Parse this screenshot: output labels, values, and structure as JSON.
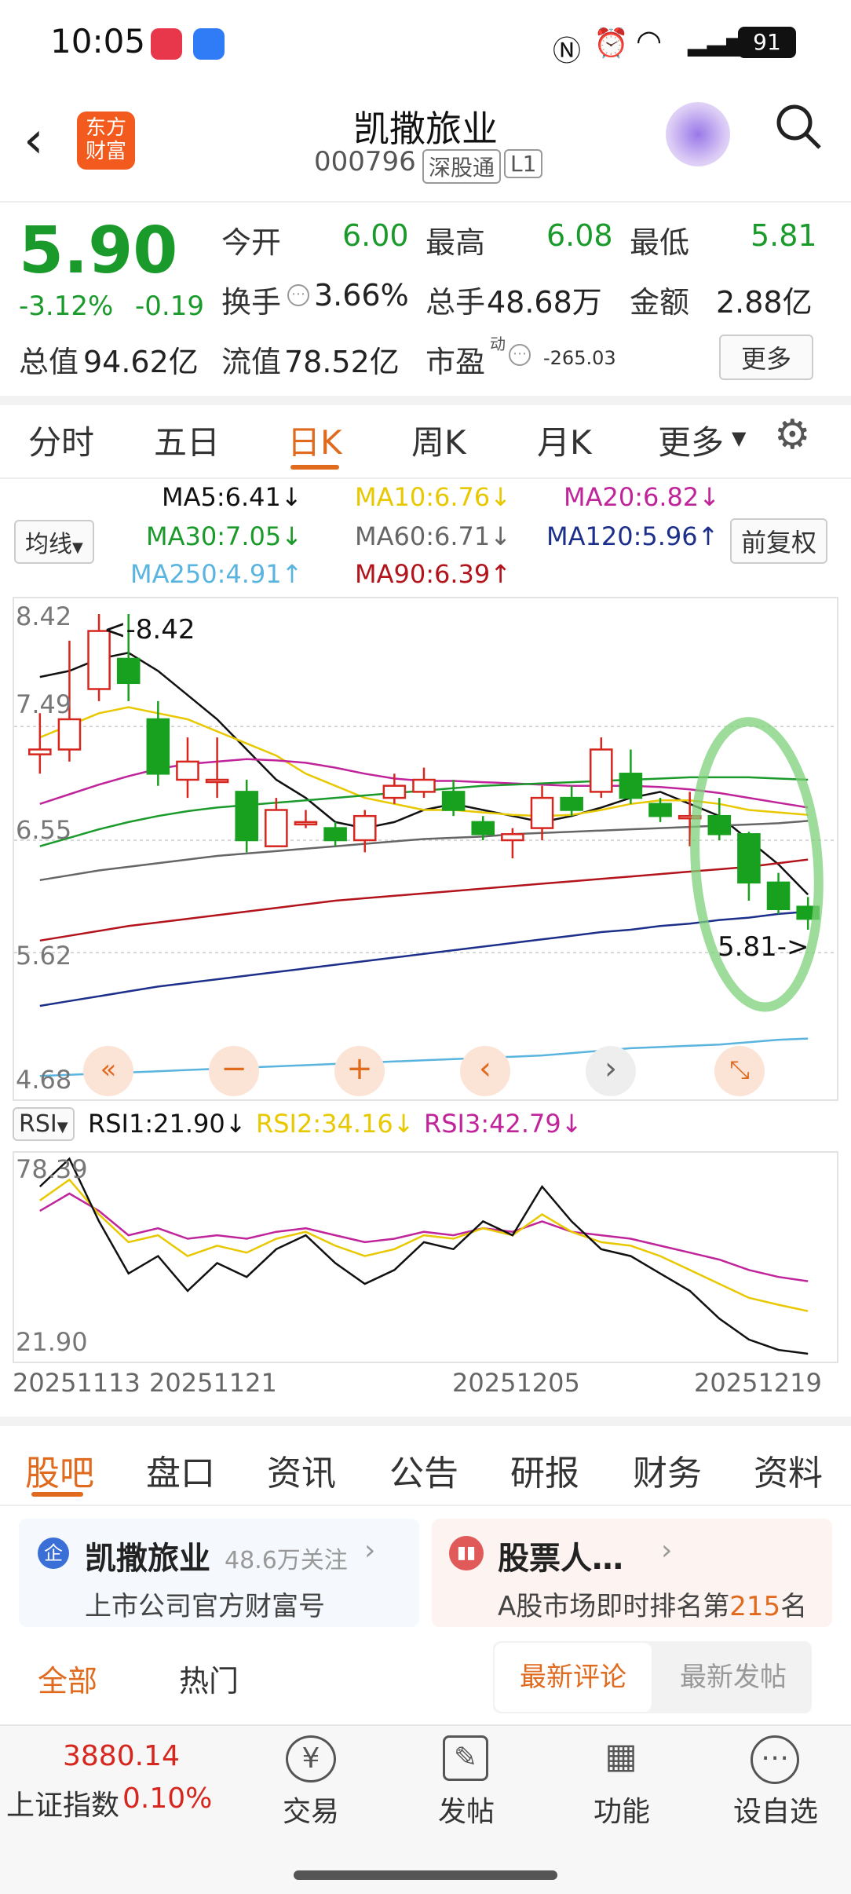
{
  "status_bar": {
    "time": "10:05",
    "battery": "91"
  },
  "header": {
    "title": "凯撒旅业",
    "code": "000796",
    "tag1": "深股通",
    "tag2": "L1",
    "logo_text": "东方财富"
  },
  "quote": {
    "price": "5.90",
    "change_pct": "-3.12%",
    "change": "-0.19",
    "open_label": "今开",
    "open": "6.00",
    "high_label": "最高",
    "high": "6.08",
    "low_label": "最低",
    "low": "5.81",
    "turnover_label": "换手",
    "turnover": "3.66%",
    "volume_label": "总手",
    "volume": "48.68万",
    "amount_label": "金额",
    "amount": "2.88亿",
    "mcap_label": "总值",
    "mcap": "94.62亿",
    "float_label": "流值",
    "float": "78.52亿",
    "pe_label": "市盈",
    "pe_sup": "动",
    "pe": "-265.03",
    "more": "更多"
  },
  "chart_tabs": [
    "分时",
    "五日",
    "日K",
    "周K",
    "月K",
    "更多"
  ],
  "ma_legend": {
    "ma5": "MA5:6.41↓",
    "ma10": "MA10:6.76↓",
    "ma20": "MA20:6.82↓",
    "ma30": "MA30:7.05↓",
    "ma60": "MA60:6.71↓",
    "ma120": "MA120:5.96↑",
    "ma250": "MA250:4.91↑",
    "ma90": "MA90:6.39↑",
    "line_select": "均线",
    "adjust": "前复权",
    "colors": {
      "ma5": "#111111",
      "ma10": "#e8c800",
      "ma20": "#c0249a",
      "ma30": "#1a9a2a",
      "ma60": "#666666",
      "ma120": "#1c2f8a",
      "ma250": "#5ab4e0",
      "ma90": "#b3131a"
    }
  },
  "kline": {
    "y_labels": [
      "8.42",
      "7.49",
      "6.55",
      "5.62",
      "4.68"
    ],
    "high_marker": "<-8.42",
    "low_marker": "5.81->"
  },
  "rsi": {
    "select": "RSI",
    "rsi1": "RSI1:21.90↓",
    "rsi2": "RSI2:34.16↓",
    "rsi3": "RSI3:42.79↓",
    "top": "78.39",
    "bottom": "21.90"
  },
  "dates": [
    "20251113",
    "20251121",
    "20251205",
    "20251219"
  ],
  "chart_data": {
    "type": "candlestick",
    "x": [
      "20251113",
      "20251121",
      "20251205",
      "20251219"
    ],
    "ylim": [
      4.68,
      8.42
    ],
    "candles": [
      {
        "o": 7.26,
        "c": 7.3,
        "h": 7.6,
        "l": 7.1
      },
      {
        "o": 7.3,
        "c": 7.55,
        "h": 8.2,
        "l": 7.2
      },
      {
        "o": 7.8,
        "c": 8.28,
        "h": 8.42,
        "l": 7.7
      },
      {
        "o": 8.05,
        "c": 7.85,
        "h": 8.42,
        "l": 7.7
      },
      {
        "o": 7.55,
        "c": 7.1,
        "h": 7.7,
        "l": 7.0
      },
      {
        "o": 7.05,
        "c": 7.2,
        "h": 7.4,
        "l": 6.9
      },
      {
        "o": 7.05,
        "c": 7.05,
        "h": 7.4,
        "l": 6.9
      },
      {
        "o": 6.95,
        "c": 6.55,
        "h": 7.05,
        "l": 6.45
      },
      {
        "o": 6.5,
        "c": 6.8,
        "h": 6.9,
        "l": 6.5
      },
      {
        "o": 6.7,
        "c": 6.7,
        "h": 6.8,
        "l": 6.65
      },
      {
        "o": 6.65,
        "c": 6.55,
        "h": 6.7,
        "l": 6.5
      },
      {
        "o": 6.55,
        "c": 6.75,
        "h": 6.8,
        "l": 6.45
      },
      {
        "o": 6.9,
        "c": 7.0,
        "h": 7.1,
        "l": 6.85
      },
      {
        "o": 6.95,
        "c": 7.05,
        "h": 7.15,
        "l": 6.9
      },
      {
        "o": 6.95,
        "c": 6.8,
        "h": 7.05,
        "l": 6.75
      },
      {
        "o": 6.7,
        "c": 6.6,
        "h": 6.75,
        "l": 6.55
      },
      {
        "o": 6.55,
        "c": 6.6,
        "h": 6.65,
        "l": 6.4
      },
      {
        "o": 6.65,
        "c": 6.9,
        "h": 7.0,
        "l": 6.55
      },
      {
        "o": 6.9,
        "c": 6.8,
        "h": 7.0,
        "l": 6.75
      },
      {
        "o": 6.95,
        "c": 7.3,
        "h": 7.4,
        "l": 6.9
      },
      {
        "o": 7.1,
        "c": 6.9,
        "h": 7.3,
        "l": 6.85
      },
      {
        "o": 6.85,
        "c": 6.75,
        "h": 6.9,
        "l": 6.7
      },
      {
        "o": 6.75,
        "c": 6.75,
        "h": 6.95,
        "l": 6.5
      },
      {
        "o": 6.75,
        "c": 6.6,
        "h": 6.9,
        "l": 6.55
      },
      {
        "o": 6.6,
        "c": 6.2,
        "h": 6.62,
        "l": 6.05
      },
      {
        "o": 6.2,
        "c": 5.98,
        "h": 6.28,
        "l": 5.94
      },
      {
        "o": 6.0,
        "c": 5.9,
        "h": 6.08,
        "l": 5.81
      }
    ],
    "ma": {
      "ma5": [
        7.9,
        7.95,
        8.05,
        8.1,
        7.95,
        7.75,
        7.55,
        7.3,
        7.05,
        6.9,
        6.7,
        6.65,
        6.7,
        6.8,
        6.85,
        6.8,
        6.75,
        6.7,
        6.75,
        6.82,
        6.9,
        6.95,
        6.85,
        6.75,
        6.55,
        6.35,
        6.1
      ],
      "ma10": [
        7.4,
        7.5,
        7.6,
        7.65,
        7.6,
        7.55,
        7.45,
        7.35,
        7.25,
        7.1,
        7.0,
        6.9,
        6.85,
        6.8,
        6.8,
        6.78,
        6.76,
        6.75,
        6.76,
        6.8,
        6.85,
        6.88,
        6.88,
        6.85,
        6.8,
        6.78,
        6.76
      ],
      "ma20": [
        6.85,
        6.93,
        7.01,
        7.08,
        7.14,
        7.18,
        7.2,
        7.22,
        7.21,
        7.19,
        7.15,
        7.1,
        7.06,
        7.04,
        7.04,
        7.03,
        7.02,
        7.01,
        7.0,
        7.0,
        7.0,
        6.99,
        6.97,
        6.94,
        6.9,
        6.86,
        6.82
      ],
      "ma30": [
        6.5,
        6.57,
        6.64,
        6.7,
        6.75,
        6.79,
        6.82,
        6.84,
        6.86,
        6.88,
        6.9,
        6.92,
        6.94,
        6.96,
        6.98,
        7.0,
        7.01,
        7.02,
        7.03,
        7.04,
        7.05,
        7.06,
        7.07,
        7.07,
        7.07,
        7.06,
        7.05
      ],
      "ma60": [
        6.22,
        6.26,
        6.3,
        6.33,
        6.36,
        6.39,
        6.42,
        6.44,
        6.46,
        6.48,
        6.5,
        6.52,
        6.54,
        6.56,
        6.57,
        6.58,
        6.6,
        6.61,
        6.62,
        6.63,
        6.64,
        6.65,
        6.66,
        6.67,
        6.68,
        6.69,
        6.71
      ],
      "ma90": [
        5.72,
        5.76,
        5.8,
        5.84,
        5.87,
        5.9,
        5.93,
        5.96,
        5.99,
        6.02,
        6.05,
        6.07,
        6.09,
        6.11,
        6.13,
        6.15,
        6.17,
        6.19,
        6.21,
        6.23,
        6.25,
        6.27,
        6.29,
        6.31,
        6.33,
        6.36,
        6.39
      ],
      "ma120": [
        5.18,
        5.22,
        5.26,
        5.3,
        5.34,
        5.37,
        5.4,
        5.43,
        5.46,
        5.49,
        5.52,
        5.55,
        5.58,
        5.61,
        5.64,
        5.67,
        5.7,
        5.73,
        5.76,
        5.79,
        5.81,
        5.84,
        5.86,
        5.89,
        5.91,
        5.94,
        5.96
      ],
      "ma250": [
        4.6,
        4.61,
        4.62,
        4.63,
        4.64,
        4.65,
        4.66,
        4.67,
        4.68,
        4.69,
        4.7,
        4.71,
        4.72,
        4.73,
        4.74,
        4.75,
        4.76,
        4.77,
        4.79,
        4.81,
        4.83,
        4.84,
        4.85,
        4.86,
        4.88,
        4.9,
        4.91
      ]
    },
    "rsi_ylim": [
      21.9,
      78.39
    ],
    "rsi1": [
      70,
      78,
      60,
      45,
      50,
      40,
      48,
      44,
      52,
      56,
      48,
      42,
      46,
      54,
      52,
      60,
      56,
      70,
      60,
      52,
      50,
      45,
      40,
      32,
      26,
      23,
      21.9
    ],
    "rsi2": [
      66,
      72,
      62,
      54,
      56,
      50,
      53,
      51,
      55,
      57,
      53,
      50,
      52,
      56,
      55,
      58,
      56,
      62,
      57,
      54,
      53,
      50,
      46,
      42,
      38,
      36,
      34.16
    ],
    "rsi3": [
      63,
      68,
      63,
      56,
      58,
      55,
      56,
      55,
      57,
      58,
      56,
      54,
      55,
      57,
      56,
      58,
      57,
      60,
      57,
      56,
      55,
      53,
      51,
      49,
      46,
      44,
      42.79
    ]
  },
  "info_tabs": [
    "股吧",
    "盘口",
    "资讯",
    "公告",
    "研报",
    "财务",
    "资料"
  ],
  "cards": {
    "left_title": "凯撒旅业",
    "left_follow": "48.6万关注",
    "left_sub": "上市公司官方财富号",
    "right_title": "股票人…",
    "right_sub_pre": "A股市场即时排名第",
    "right_rank": "215",
    "right_sub_post": "名"
  },
  "filters": {
    "all": "全部",
    "hot": "热门",
    "latest_comment": "最新评论",
    "latest_post": "最新发帖"
  },
  "bottom": {
    "index_value": "3880.14",
    "index_name": "上证指数",
    "index_change": "0.10%",
    "trade": "交易",
    "post": "发帖",
    "func": "功能",
    "watch": "设自选"
  }
}
